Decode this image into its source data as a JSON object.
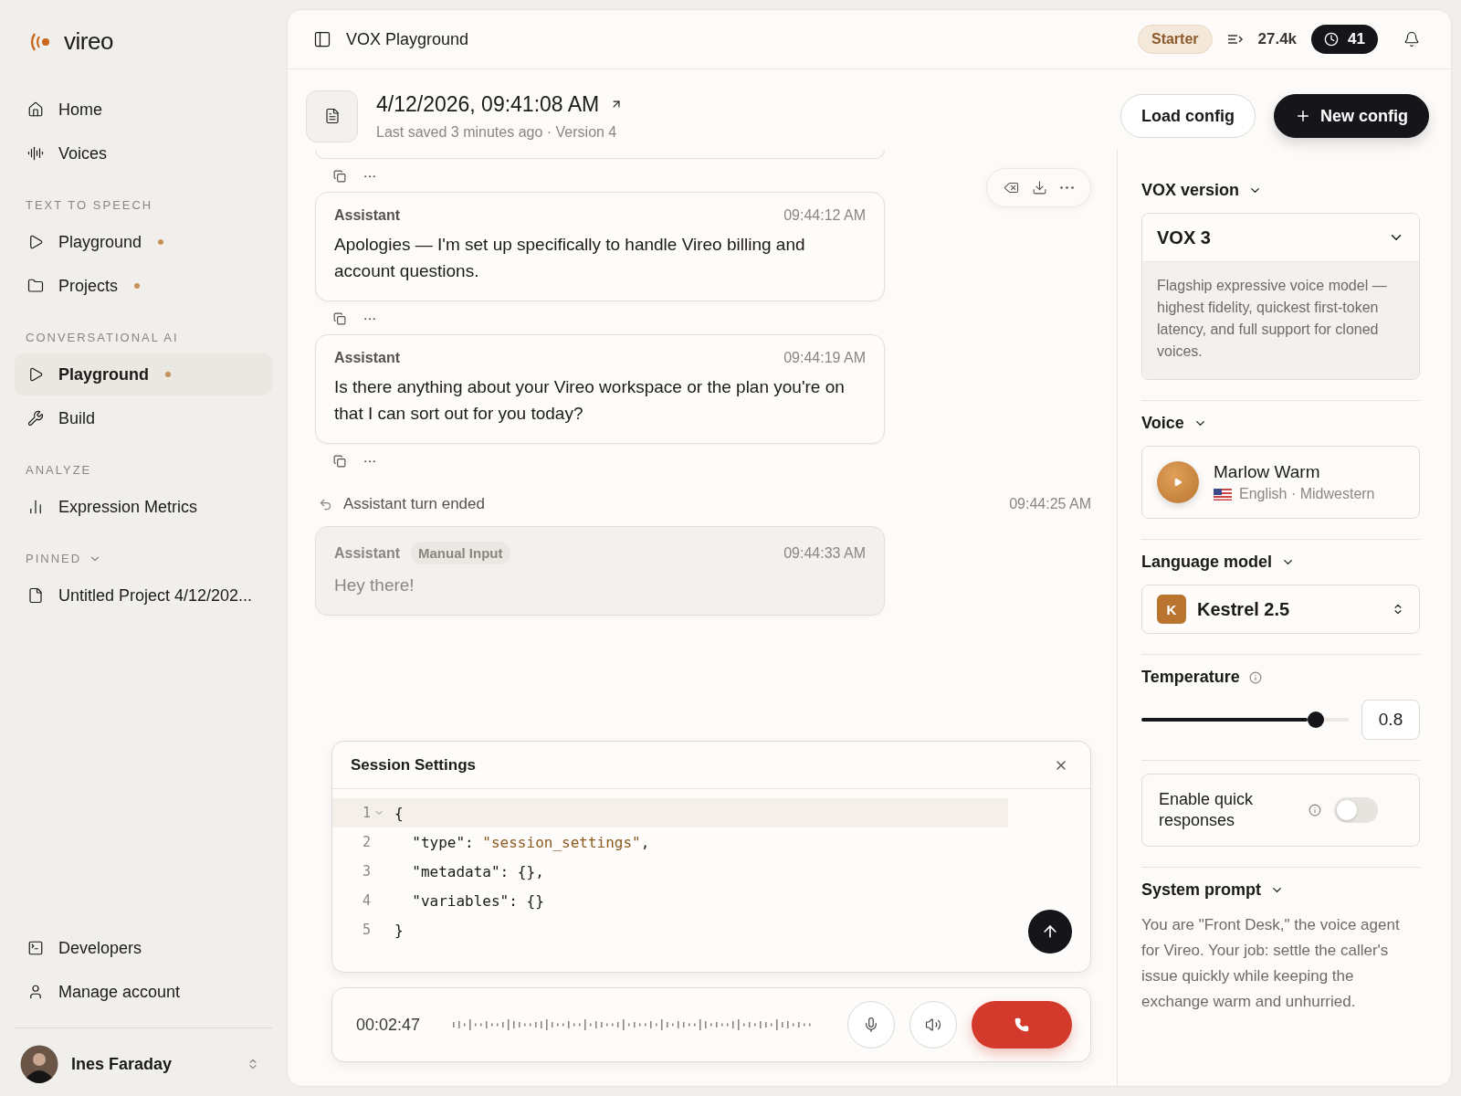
{
  "brand": {
    "name": "vireo"
  },
  "sidebar": {
    "top_items": [
      {
        "label": "Home",
        "selected": false,
        "dot": false
      },
      {
        "label": "Voices",
        "selected": false,
        "dot": false
      }
    ],
    "sections": [
      {
        "label": "TEXT TO SPEECH",
        "items": [
          {
            "label": "Playground",
            "selected": false,
            "dot": true
          },
          {
            "label": "Projects",
            "selected": false,
            "dot": true
          }
        ]
      },
      {
        "label": "CONVERSATIONAL AI",
        "items": [
          {
            "label": "Playground",
            "selected": true,
            "dot": true
          },
          {
            "label": "Build",
            "selected": false,
            "dot": false
          }
        ]
      },
      {
        "label": "ANALYZE",
        "items": [
          {
            "label": "Expression Metrics",
            "selected": false,
            "dot": false
          }
        ]
      },
      {
        "label": "PINNED",
        "expanded": true,
        "items": [
          {
            "label": "Untitled Project 4/12/202...",
            "selected": false,
            "dot": false
          }
        ]
      }
    ],
    "bottom_items": [
      {
        "label": "Developers",
        "selected": false,
        "dot": false
      },
      {
        "label": "Manage account",
        "selected": false,
        "dot": false
      }
    ],
    "user": {
      "name": "Ines Faraday"
    }
  },
  "header": {
    "title": "VOX Playground",
    "plan": "Starter",
    "credits": "27.4k",
    "timer": "41"
  },
  "document": {
    "title": "4/12/2026, 09:41:08 AM",
    "subtitle": "Last saved 3 minutes ago · Version 4",
    "buttons": [
      {
        "label": "Load config",
        "kind": "secondary"
      },
      {
        "label": "New config",
        "kind": "primary"
      }
    ]
  },
  "messages": [
    {
      "kind": "stub"
    },
    {
      "kind": "message",
      "role": "Assistant",
      "time": "09:44:12 AM",
      "text": "Apologies — I'm set up specifically to handle Vireo billing and account questions."
    },
    {
      "kind": "message",
      "role": "Assistant",
      "time": "09:44:19 AM",
      "text": "Is there anything about your Vireo workspace or the plan you're on that I can sort out for you today?"
    },
    {
      "kind": "event",
      "text": "Assistant turn ended",
      "time": "09:44:25 AM"
    },
    {
      "kind": "manual",
      "role": "Assistant",
      "tag": "Manual Input",
      "time": "09:44:33 AM",
      "text": "Hey there!"
    }
  ],
  "session_settings": {
    "title": "Session Settings",
    "lines": [
      {
        "number": "1",
        "active": true,
        "foldable": true,
        "tokens": [
          {
            "kind": "plain",
            "text": "{"
          }
        ]
      },
      {
        "number": "2",
        "active": false,
        "foldable": false,
        "tokens": [
          {
            "kind": "plain",
            "text": "  \"type\": "
          },
          {
            "kind": "string",
            "text": "\"session_settings\""
          },
          {
            "kind": "plain",
            "text": ","
          }
        ]
      },
      {
        "number": "3",
        "active": false,
        "foldable": false,
        "tokens": [
          {
            "kind": "plain",
            "text": "  \"metadata\": {},"
          }
        ]
      },
      {
        "number": "4",
        "active": false,
        "foldable": false,
        "tokens": [
          {
            "kind": "plain",
            "text": "  \"variables\": {}"
          }
        ]
      },
      {
        "number": "5",
        "active": false,
        "foldable": false,
        "tokens": [
          {
            "kind": "plain",
            "text": "}"
          }
        ]
      }
    ]
  },
  "call_bar": {
    "elapsed": "00:02:47"
  },
  "settings": {
    "vox_version": {
      "label": "VOX version",
      "value": "VOX 3",
      "description": "Flagship expressive voice model — highest fidelity, quickest first-token latency, and full support for cloned voices."
    },
    "voice": {
      "label": "Voice",
      "name": "Marlow Warm",
      "details": "English · Midwestern"
    },
    "language_model": {
      "label": "Language model",
      "initial": "K",
      "value": "Kestrel 2.5"
    },
    "temperature": {
      "label": "Temperature",
      "level": 0.8,
      "reading": "0.8"
    },
    "quick_responses": {
      "label": "Enable quick responses",
      "on": false
    },
    "system_prompt": {
      "label": "System prompt",
      "text": "You are \"Front Desk,\" the voice agent for Vireo. Your job: settle the caller's issue quickly while keeping the exchange warm and unhurried."
    }
  }
}
